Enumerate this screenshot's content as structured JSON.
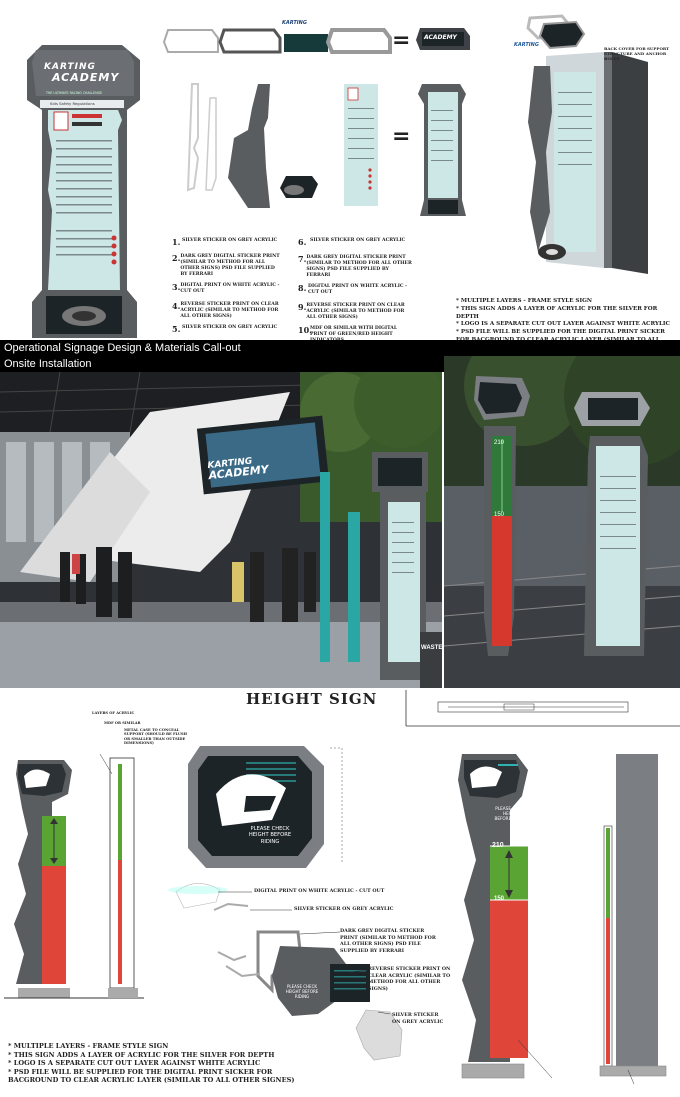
{
  "brand": {
    "logo_line1": "KARTING",
    "logo_line2": "ACADEMY",
    "tagline": "THE ULTIMATE RACING CHALLENGE",
    "rules_heading": "Kids Safety Regulations"
  },
  "materials_top": [
    {
      "n": "1.",
      "text": "SILVER STICKER ON GREY ACRYLIC"
    },
    {
      "n": "2.",
      "text": "DARK GREY DIGITAL STICKER PRINT (SIMILAR TO METHOD FOR ALL OTHER SIGNS) PSD FILE SUPPLIED BY FERRARI"
    },
    {
      "n": "3.",
      "text": "DIGITAL PRINT ON WHITE ACRYLIC - CUT OUT"
    },
    {
      "n": "4.",
      "text": "REVERSE STICKER PRINT ON CLEAR ACRYLIC (SIMILAR TO METHOD FOR ALL OTHER SIGNS)"
    },
    {
      "n": "5.",
      "text": "SILVER STICKER ON GREY ACRYLIC"
    },
    {
      "n": "6.",
      "text": "SILVER STICKER ON GREY ACRYLIC"
    },
    {
      "n": "7.",
      "text": "DARK GREY DIGITAL STICKER PRINT (SIMILAR TO METHOD FOR ALL OTHER SIGNS) PSD FILE SUPPLIED BY FERRARI"
    },
    {
      "n": "8.",
      "text": "DIGITAL PRINT ON WHITE ACRYLIC - CUT OUT"
    },
    {
      "n": "9.",
      "text": "REVERSE STICKER PRINT ON CLEAR ACRYLIC (SIMILAR TO METHOD FOR ALL OTHER SIGNS)"
    },
    {
      "n": "10.",
      "text": "MDF OR SIMILAR WITH DIGITAL PRINT OF GREEN/RED HEIGHT INDICATORS"
    }
  ],
  "back_cover_note": "BACK COVER FOR SUPPORT STRUCTURE AND ANCHOR BOLTS",
  "notes_top": [
    "* MULTIPLE LAYERS - FRAME STYLE SIGN",
    "* THIS SIGN ADDS A LAYER OF ACRYLIC FOR THE SILVER FOR DEPTH",
    "* LOGO IS A SEPARATE CUT OUT LAYER AGAINST WHITE ACRYLIC",
    "* PSD FILE WILL BE SUPPLIED FOR THE DIGITAL PRINT SICKER FOR BACGROUND TO CLEAR ACRYLIC LAYER (SIMILAR TO ALL OTHER SIGNES)"
  ],
  "captions": {
    "section1": "Operational Signage Design & Materials Call-out",
    "section2": "Onsite Installation"
  },
  "photo": {
    "waste_label": "WASTE"
  },
  "equals": "=",
  "height_sign": {
    "title": "HEIGHT SIGN",
    "section_labels": [
      "LAYERS OF ACRYLIC",
      "MDF OR SIMILAR",
      "METAL CASE TO CONCEAL SUPPORT (SHOULD BE FLUSH OR SMALLER THAN OUTSIDE DIMENSIONS)"
    ],
    "check_text": "PLEASE CHECK HEIGHT BEFORE RIDING",
    "mark_210": "210",
    "mark_150": "150",
    "callouts": [
      "DIGITAL PRINT ON WHITE ACRYLIC - CUT OUT",
      "SILVER STICKER ON GREY ACRYLIC",
      "DARK GREY DIGITAL STICKER PRINT (SIMILAR TO METHOD FOR ALL OTHER SIGNS) PSD FILE SUPPLIED BY FERRARI",
      "REVERSE STICKER PRINT ON CLEAR ACRYLIC (SIMILAR TO METHOD FOR ALL OTHER SIGNS)",
      "SILVER STICKER ON GREY ACRYLIC"
    ],
    "notes": [
      "* MULTIPLE LAYERS - FRAME STYLE SIGN",
      "* THIS SIGN ADDS A LAYER OF ACRYLIC FOR THE SILVER FOR DEPTH",
      "* LOGO IS A SEPARATE CUT OUT LAYER AGAINST WHITE ACRYLIC",
      "* PSD FILE WILL BE SUPPLIED FOR THE DIGITAL PRINT SICKER FOR BACGROUND TO CLEAR ACRYLIC LAYER (SIMILAR TO ALL OTHER SIGNES)"
    ]
  },
  "colors": {
    "frame_grey": "#5a5d60",
    "frame_light": "#b8bcc0",
    "panel_mint": "#cde6e6",
    "teal": "#2fb3b0",
    "green": "#5aa434",
    "red": "#e0453a",
    "dark": "#1d2428"
  }
}
